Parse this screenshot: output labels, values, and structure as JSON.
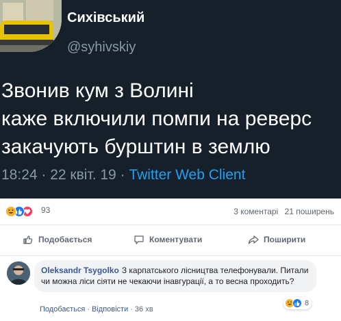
{
  "tweet": {
    "name": "Сихівський",
    "handle": "@syhivskiy",
    "lines": [
      "Звонив кум з Волині",
      "каже включили помпи на реверс",
      "закачують бурштин в землю"
    ],
    "time": "18:24 · 22 квіт. 19 · ",
    "client": "Twitter Web Client"
  },
  "post": {
    "reaction_count": "93",
    "comments": "3 коментарі",
    "shares": "21 поширень",
    "reactions": [
      "haha",
      "like",
      "love"
    ],
    "actions": {
      "like": "Подобається",
      "comment": "Коментувати",
      "share": "Поширити"
    }
  },
  "comment": {
    "author": "Oleksandr Tsygolko",
    "text": "З карпатського лісництва телефонували. Питали чи можна ліси сіяти не чекаючи інавгурації, а то весна проходить?",
    "reaction_count": "8",
    "like": "Подобається",
    "reply": "Відповісти",
    "age": "36 хв"
  },
  "colors": {
    "tweet_bg": "#15202b",
    "twitter_blue": "#1da1f2",
    "fb_link": "#385898",
    "haha": "#f7b125",
    "like": "#1877f2",
    "love": "#f33e58"
  }
}
